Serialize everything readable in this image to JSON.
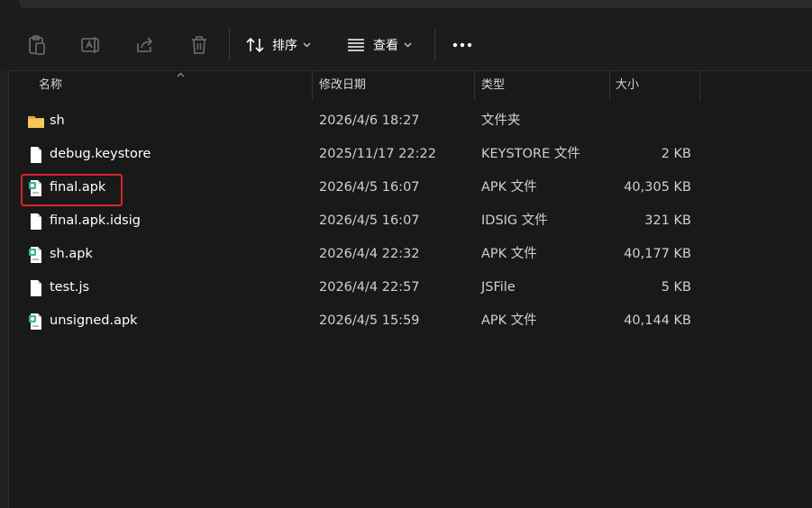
{
  "toolbar": {
    "sort_label": "排序",
    "view_label": "查看",
    "icons": [
      "paste-icon",
      "rename-icon",
      "share-icon",
      "delete-icon",
      "sort-icon",
      "view-icon",
      "more-icon"
    ]
  },
  "columns": {
    "name": "名称",
    "date": "修改日期",
    "type": "类型",
    "size": "大小"
  },
  "files": [
    {
      "name": "sh",
      "date": "2026/4/6 18:27",
      "type": "文件夹",
      "size": "",
      "icon": "folder-icon"
    },
    {
      "name": "debug.keystore",
      "date": "2025/11/17 22:22",
      "type": "KEYSTORE 文件",
      "size": "2 KB",
      "icon": "file-icon"
    },
    {
      "name": "final.apk",
      "date": "2026/4/5 16:07",
      "type": "APK 文件",
      "size": "40,305 KB",
      "icon": "apk-file-icon"
    },
    {
      "name": "final.apk.idsig",
      "date": "2026/4/5 16:07",
      "type": "IDSIG 文件",
      "size": "321 KB",
      "icon": "file-icon"
    },
    {
      "name": "sh.apk",
      "date": "2026/4/4 22:32",
      "type": "APK 文件",
      "size": "40,177 KB",
      "icon": "apk-file-icon"
    },
    {
      "name": "test.js",
      "date": "2026/4/4 22:57",
      "type": "JSFile",
      "size": "5 KB",
      "icon": "file-icon"
    },
    {
      "name": "unsigned.apk",
      "date": "2026/4/5 15:59",
      "type": "APK 文件",
      "size": "40,144 KB",
      "icon": "apk-file-icon"
    }
  ],
  "colors": {
    "background": "#191919",
    "highlight": "#d9232e",
    "folder": "#f2c14e",
    "apk_accent": "#3fb68b"
  }
}
